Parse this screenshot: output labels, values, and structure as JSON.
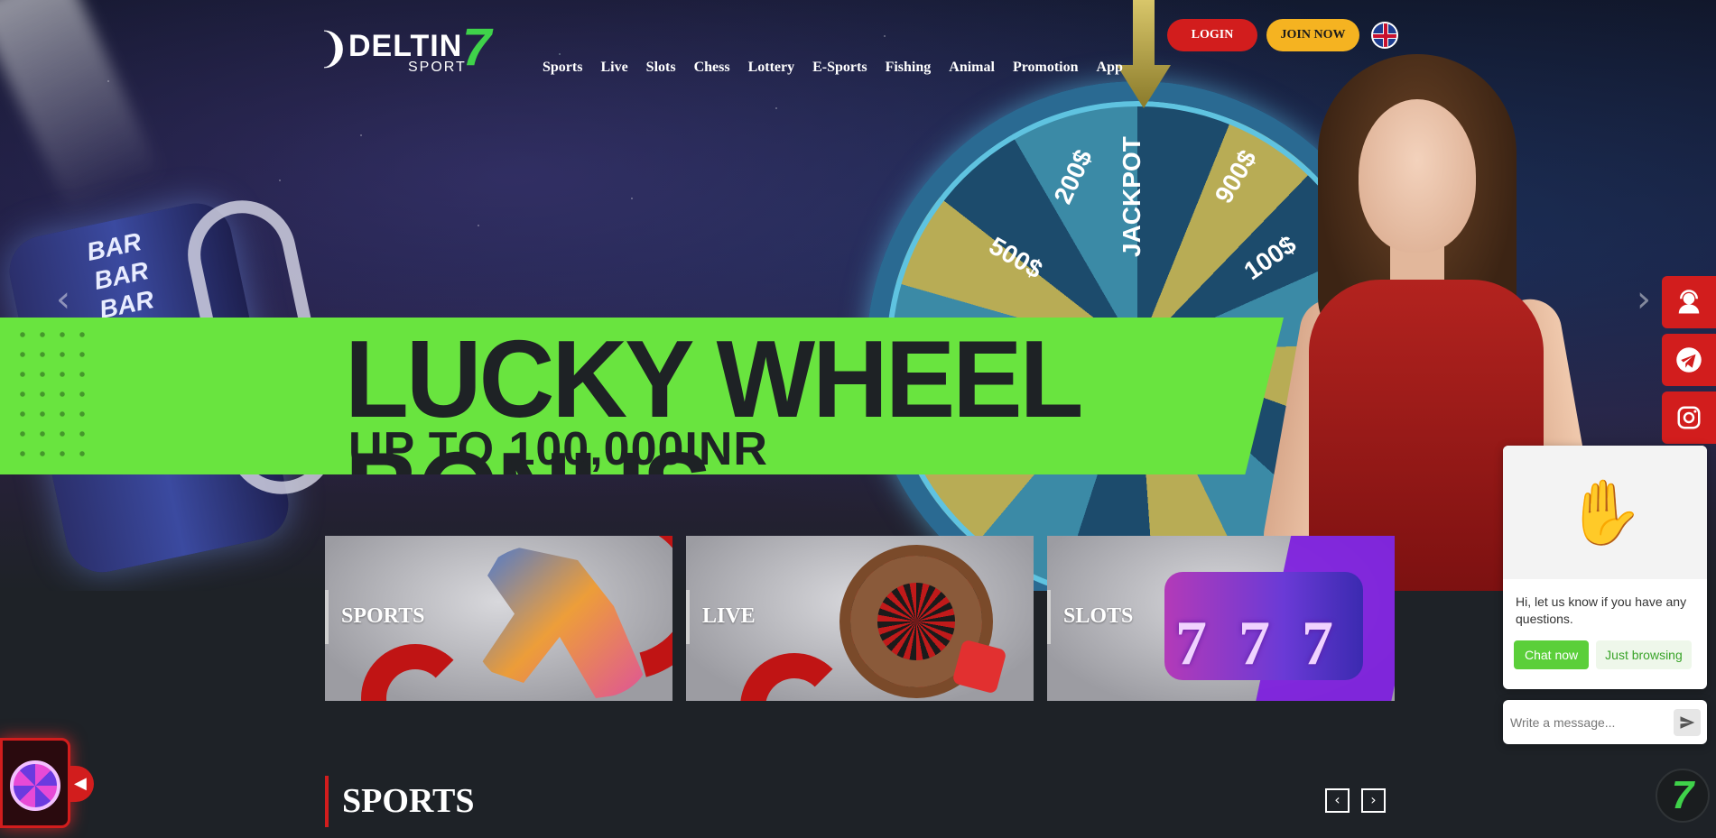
{
  "brand": {
    "name": "DELTIN",
    "number": "7",
    "sub": "SPORT"
  },
  "nav": [
    "Sports",
    "Live",
    "Slots",
    "Chess",
    "Lottery",
    "E-Sports",
    "Fishing",
    "Animal",
    "Promotion",
    "App"
  ],
  "auth": {
    "login": "LOGIN",
    "join": "JOIN NOW"
  },
  "language": {
    "icon": "uk-flag-icon"
  },
  "banner": {
    "title": "LUCKY WHEEL BONUS",
    "subtitle": "UP TO 100,000INR",
    "wheel_labels": [
      "JACKPOT",
      "200$",
      "900$",
      "500$",
      "100$"
    ],
    "reel_labels": [
      "BAR",
      "BAR",
      "BAR"
    ],
    "accent_color": "#69e43f"
  },
  "categories": [
    {
      "label": "SPORTS"
    },
    {
      "label": "LIVE"
    },
    {
      "label": "SLOTS"
    }
  ],
  "section": {
    "title": "SPORTS"
  },
  "social": [
    "support-agent-icon",
    "telegram-icon",
    "instagram-icon"
  ],
  "chat": {
    "greeting": "Hi, let us know if you have any questions.",
    "chat_now": "Chat now",
    "just_browsing": "Just browsing",
    "placeholder": "Write a message..."
  },
  "colors": {
    "primary_red": "#d21d1d",
    "join_yellow": "#f5b321",
    "banner_green": "#69e43f",
    "bg": "#1e2227"
  }
}
